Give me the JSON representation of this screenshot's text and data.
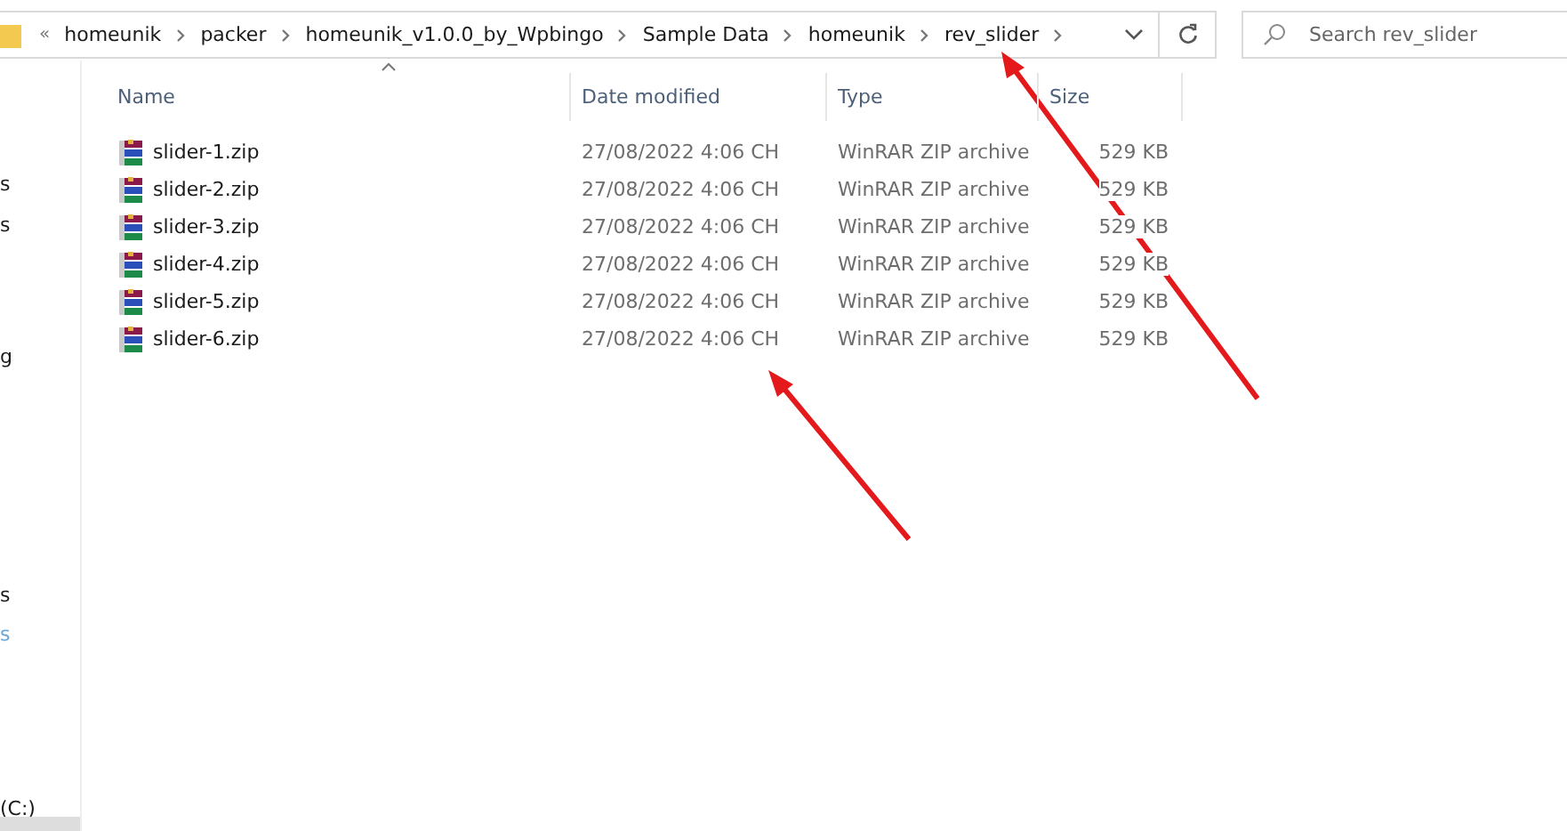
{
  "address_bar": {
    "overflow": "«",
    "crumbs": [
      "homeunik",
      "packer",
      "homeunik_v1.0.0_by_Wpbingo",
      "Sample Data",
      "homeunik",
      "rev_slider"
    ]
  },
  "search": {
    "placeholder": "Search rev_slider"
  },
  "sidebar": {
    "items": [
      {
        "label": "s",
        "kind": "normal"
      },
      {
        "label": "s",
        "kind": "normal"
      },
      {
        "label": "g",
        "kind": "normal"
      },
      {
        "label": "s",
        "kind": "normal"
      },
      {
        "label": "s",
        "kind": "link"
      },
      {
        "label": "(C:)",
        "kind": "normal"
      }
    ]
  },
  "table": {
    "columns": [
      "Name",
      "Date modified",
      "Type",
      "Size"
    ],
    "rows": [
      {
        "name": "slider-1.zip",
        "date": "27/08/2022 4:06 CH",
        "type": "WinRAR ZIP archive",
        "size": "529 KB"
      },
      {
        "name": "slider-2.zip",
        "date": "27/08/2022 4:06 CH",
        "type": "WinRAR ZIP archive",
        "size": "529 KB"
      },
      {
        "name": "slider-3.zip",
        "date": "27/08/2022 4:06 CH",
        "type": "WinRAR ZIP archive",
        "size": "529 KB"
      },
      {
        "name": "slider-4.zip",
        "date": "27/08/2022 4:06 CH",
        "type": "WinRAR ZIP archive",
        "size": "529 KB"
      },
      {
        "name": "slider-5.zip",
        "date": "27/08/2022 4:06 CH",
        "type": "WinRAR ZIP archive",
        "size": "529 KB"
      },
      {
        "name": "slider-6.zip",
        "date": "27/08/2022 4:06 CH",
        "type": "WinRAR ZIP archive",
        "size": "529 KB"
      }
    ]
  }
}
